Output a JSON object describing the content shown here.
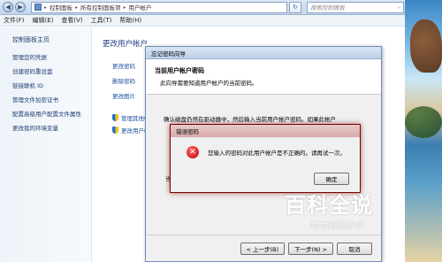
{
  "explorer": {
    "address": {
      "crumbs": [
        "控制面板",
        "所有控制面板项",
        "用户帐户"
      ]
    },
    "search": {
      "placeholder": "搜索控制面板"
    },
    "menu": [
      "文件(F)",
      "编辑(E)",
      "查看(V)",
      "工具(T)",
      "帮助(H)"
    ],
    "sidebar": {
      "home": "控制面板主页",
      "links": [
        "管理您的凭据",
        "创建密码重设盘",
        "链接联机 ID",
        "管理文件加密证书",
        "配置高级用户配置文件属性",
        "更改我的环境变量"
      ]
    },
    "main": {
      "heading": "更改用户帐户",
      "tasks": [
        "更改密码",
        "删除密码",
        "更改图片"
      ],
      "shield_tasks": [
        "管理其他帐户",
        "更改用户帐户"
      ]
    }
  },
  "wizard": {
    "title": "忘记密码向导",
    "header_title": "当前用户帐户密码",
    "header_subtitle": "此向导需要知道用户帐户的当前密码。",
    "body_text": "确认磁盘仍然在驱动器中，然后输入当前用户帐户密码。如果此帐户",
    "body_text2": "当",
    "buttons": {
      "back": "< 上一步(B)",
      "next": "下一步(N) >",
      "cancel": "取消"
    }
  },
  "error_dialog": {
    "title": "错误密码",
    "message": "您输入的密码对此用户帐户是不正确的。请再试一次。",
    "ok": "确定",
    "icon": "error-icon"
  },
  "watermark": {
    "main": "百科全说",
    "sub": "助你轻松解决"
  }
}
